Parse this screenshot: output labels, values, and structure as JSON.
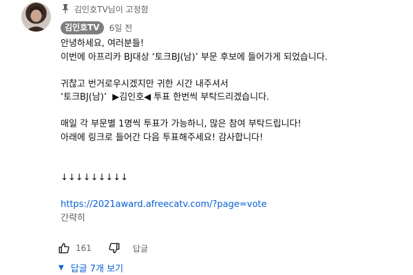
{
  "pinned_label": "김인호TV님이 고정함",
  "author": {
    "name": "김인호TV"
  },
  "timestamp": "6일 전",
  "comment": {
    "line1": "안녕하세요, 여러분들!",
    "line2": "이번에 아프리카 BJ대상 ‘토크BJ(남)’ 부문 후보에 들어가게 되었습니다.",
    "line3": "귀찮고 번거로우시겠지만 귀한 시간 내주셔서",
    "line4": "‘토크BJ(남)’  ▶김인호◀ 투표 한번씩 부탁드리겠습니다.",
    "line5": "매일 각 부문별 1명씩 투표가 가능하니, 많은 참여 부탁드립니다!",
    "line6": "아래에 링크로 들어간 다음 투표해주세요! 감사합니다!",
    "arrows": "↓↓↓↓↓↓↓↓↓",
    "link": "https://2021award.afreecatv.com/?page=vote",
    "collapse": "간략히"
  },
  "actions": {
    "like_count": "161",
    "reply": "답글"
  },
  "view_replies": "답글 7개 보기",
  "icons": {
    "pin": "pin-icon",
    "like": "thumbs-up-icon",
    "dislike": "thumbs-down-icon",
    "expand": "caret-down-icon"
  },
  "colors": {
    "link": "#065fd4",
    "badge": "#7f7f7f",
    "secondary_text": "#606060"
  }
}
